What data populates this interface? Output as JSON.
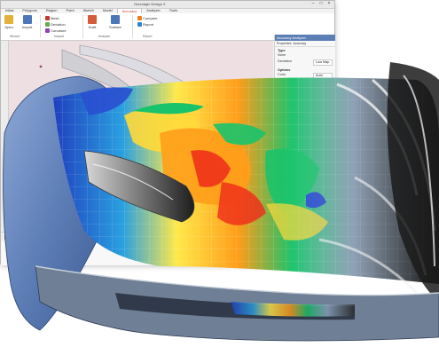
{
  "window": {
    "title": "Geomagic Design X",
    "controls": [
      "–",
      "□",
      "×"
    ]
  },
  "ribbon": {
    "tabs": [
      "Initial",
      "Polygons",
      "Region",
      "Point",
      "Sketch",
      "Model",
      "Accuracy",
      "Analyzer",
      "Tools"
    ],
    "active_tab": "Accuracy",
    "buttons": [
      {
        "label": "Open",
        "icon": "folder-icon"
      },
      {
        "label": "Import",
        "icon": "import-icon"
      },
      {
        "label": "Mesh",
        "icon": "mesh-icon"
      },
      {
        "label": "Deviation",
        "icon": "deviation-icon"
      },
      {
        "label": "Curvature",
        "icon": "curvature-icon"
      },
      {
        "label": "Draft",
        "icon": "draft-icon"
      },
      {
        "label": "Surface",
        "icon": "surface-icon"
      },
      {
        "label": "Compare",
        "icon": "compare-icon"
      },
      {
        "label": "Report",
        "icon": "report-icon"
      }
    ],
    "group_labels": [
      "Wizard",
      "Inspect",
      "Analysis",
      "Report"
    ]
  },
  "properties_panel": {
    "title": "Accuracy Analyzer",
    "tabs": [
      "Properties",
      "Accuracy"
    ],
    "groups": [
      {
        "name": "Type",
        "rows": [
          {
            "label": "None",
            "value": ""
          },
          {
            "label": "Deviation",
            "value": "Low Map"
          }
        ]
      },
      {
        "name": "Options",
        "rows": [
          {
            "label": "Color",
            "value": "Auto"
          },
          {
            "label": "Range",
            "value": ""
          },
          {
            "label": "Tolerance",
            "value": ""
          },
          {
            "label": "Ref",
            "value": "Mesh"
          }
        ]
      }
    ]
  },
  "colors": {
    "viewport_bg": "#ead9dc",
    "accent": "#c0392b",
    "panel_header": "#5b7fb5"
  },
  "scene": {
    "subject": "car-front-bumper-deviation-map",
    "heatmap_colors": [
      "#1f3fbf",
      "#2aa0e0",
      "#19c36b",
      "#ffe94a",
      "#ff9d1a",
      "#ef2a1a"
    ]
  }
}
